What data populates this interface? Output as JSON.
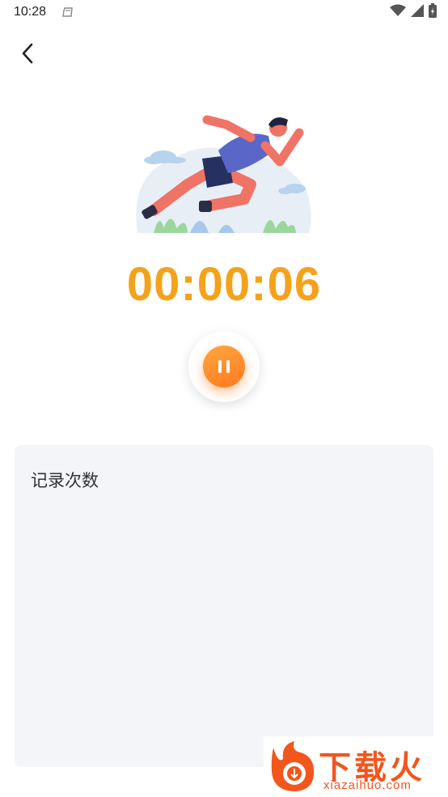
{
  "status_bar": {
    "time": "10:28",
    "icons": [
      "notification-icon",
      "wifi-icon",
      "signal-icon",
      "battery-icon"
    ]
  },
  "nav": {
    "back_icon": "chevron-left-icon"
  },
  "illustration": {
    "name": "runner-illustration"
  },
  "timer": {
    "value": "00:00:06",
    "color": "#F5A21B"
  },
  "control": {
    "icon": "pause-icon",
    "accent": "#FF8A2B"
  },
  "record": {
    "title": "记录次数"
  },
  "watermark": {
    "brand": "下载火",
    "url": "xiazaihuo.com",
    "color": "#F2561D"
  }
}
